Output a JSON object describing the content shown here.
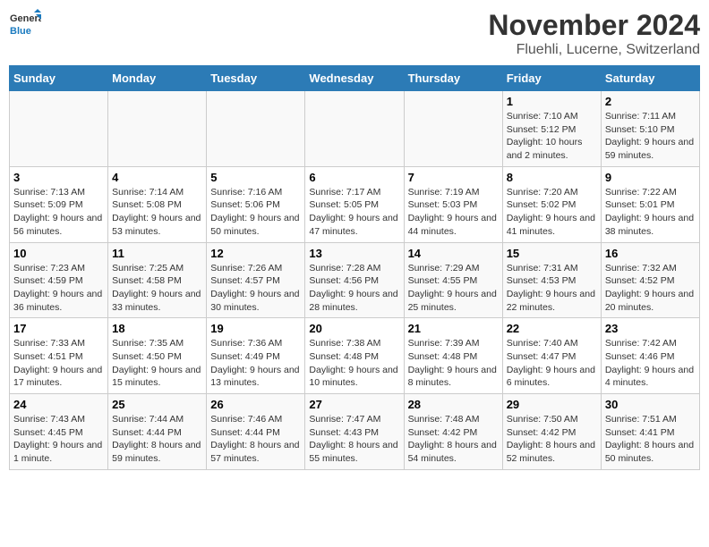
{
  "logo": {
    "line1": "General",
    "line2": "Blue"
  },
  "title": "November 2024",
  "location": "Fluehli, Lucerne, Switzerland",
  "weekdays": [
    "Sunday",
    "Monday",
    "Tuesday",
    "Wednesday",
    "Thursday",
    "Friday",
    "Saturday"
  ],
  "weeks": [
    [
      {
        "day": "",
        "info": ""
      },
      {
        "day": "",
        "info": ""
      },
      {
        "day": "",
        "info": ""
      },
      {
        "day": "",
        "info": ""
      },
      {
        "day": "",
        "info": ""
      },
      {
        "day": "1",
        "info": "Sunrise: 7:10 AM\nSunset: 5:12 PM\nDaylight: 10 hours and 2 minutes."
      },
      {
        "day": "2",
        "info": "Sunrise: 7:11 AM\nSunset: 5:10 PM\nDaylight: 9 hours and 59 minutes."
      }
    ],
    [
      {
        "day": "3",
        "info": "Sunrise: 7:13 AM\nSunset: 5:09 PM\nDaylight: 9 hours and 56 minutes."
      },
      {
        "day": "4",
        "info": "Sunrise: 7:14 AM\nSunset: 5:08 PM\nDaylight: 9 hours and 53 minutes."
      },
      {
        "day": "5",
        "info": "Sunrise: 7:16 AM\nSunset: 5:06 PM\nDaylight: 9 hours and 50 minutes."
      },
      {
        "day": "6",
        "info": "Sunrise: 7:17 AM\nSunset: 5:05 PM\nDaylight: 9 hours and 47 minutes."
      },
      {
        "day": "7",
        "info": "Sunrise: 7:19 AM\nSunset: 5:03 PM\nDaylight: 9 hours and 44 minutes."
      },
      {
        "day": "8",
        "info": "Sunrise: 7:20 AM\nSunset: 5:02 PM\nDaylight: 9 hours and 41 minutes."
      },
      {
        "day": "9",
        "info": "Sunrise: 7:22 AM\nSunset: 5:01 PM\nDaylight: 9 hours and 38 minutes."
      }
    ],
    [
      {
        "day": "10",
        "info": "Sunrise: 7:23 AM\nSunset: 4:59 PM\nDaylight: 9 hours and 36 minutes."
      },
      {
        "day": "11",
        "info": "Sunrise: 7:25 AM\nSunset: 4:58 PM\nDaylight: 9 hours and 33 minutes."
      },
      {
        "day": "12",
        "info": "Sunrise: 7:26 AM\nSunset: 4:57 PM\nDaylight: 9 hours and 30 minutes."
      },
      {
        "day": "13",
        "info": "Sunrise: 7:28 AM\nSunset: 4:56 PM\nDaylight: 9 hours and 28 minutes."
      },
      {
        "day": "14",
        "info": "Sunrise: 7:29 AM\nSunset: 4:55 PM\nDaylight: 9 hours and 25 minutes."
      },
      {
        "day": "15",
        "info": "Sunrise: 7:31 AM\nSunset: 4:53 PM\nDaylight: 9 hours and 22 minutes."
      },
      {
        "day": "16",
        "info": "Sunrise: 7:32 AM\nSunset: 4:52 PM\nDaylight: 9 hours and 20 minutes."
      }
    ],
    [
      {
        "day": "17",
        "info": "Sunrise: 7:33 AM\nSunset: 4:51 PM\nDaylight: 9 hours and 17 minutes."
      },
      {
        "day": "18",
        "info": "Sunrise: 7:35 AM\nSunset: 4:50 PM\nDaylight: 9 hours and 15 minutes."
      },
      {
        "day": "19",
        "info": "Sunrise: 7:36 AM\nSunset: 4:49 PM\nDaylight: 9 hours and 13 minutes."
      },
      {
        "day": "20",
        "info": "Sunrise: 7:38 AM\nSunset: 4:48 PM\nDaylight: 9 hours and 10 minutes."
      },
      {
        "day": "21",
        "info": "Sunrise: 7:39 AM\nSunset: 4:48 PM\nDaylight: 9 hours and 8 minutes."
      },
      {
        "day": "22",
        "info": "Sunrise: 7:40 AM\nSunset: 4:47 PM\nDaylight: 9 hours and 6 minutes."
      },
      {
        "day": "23",
        "info": "Sunrise: 7:42 AM\nSunset: 4:46 PM\nDaylight: 9 hours and 4 minutes."
      }
    ],
    [
      {
        "day": "24",
        "info": "Sunrise: 7:43 AM\nSunset: 4:45 PM\nDaylight: 9 hours and 1 minute."
      },
      {
        "day": "25",
        "info": "Sunrise: 7:44 AM\nSunset: 4:44 PM\nDaylight: 8 hours and 59 minutes."
      },
      {
        "day": "26",
        "info": "Sunrise: 7:46 AM\nSunset: 4:44 PM\nDaylight: 8 hours and 57 minutes."
      },
      {
        "day": "27",
        "info": "Sunrise: 7:47 AM\nSunset: 4:43 PM\nDaylight: 8 hours and 55 minutes."
      },
      {
        "day": "28",
        "info": "Sunrise: 7:48 AM\nSunset: 4:42 PM\nDaylight: 8 hours and 54 minutes."
      },
      {
        "day": "29",
        "info": "Sunrise: 7:50 AM\nSunset: 4:42 PM\nDaylight: 8 hours and 52 minutes."
      },
      {
        "day": "30",
        "info": "Sunrise: 7:51 AM\nSunset: 4:41 PM\nDaylight: 8 hours and 50 minutes."
      }
    ]
  ]
}
